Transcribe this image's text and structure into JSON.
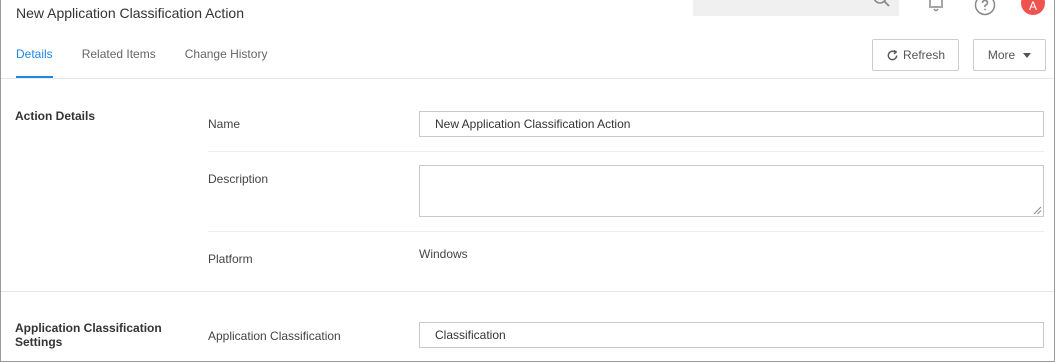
{
  "header": {
    "title": "New Application Classification Action",
    "avatar_initial": "A",
    "avatar_color": "#ef5350"
  },
  "tabs": [
    {
      "label": "Details",
      "active": true
    },
    {
      "label": "Related Items",
      "active": false
    },
    {
      "label": "Change History",
      "active": false
    }
  ],
  "toolbar": {
    "refresh_label": "Refresh",
    "more_label": "More"
  },
  "action_details": {
    "section_title": "Action Details",
    "name_label": "Name",
    "name_value": "New Application Classification Action",
    "description_label": "Description",
    "description_value": "",
    "platform_label": "Platform",
    "platform_value": "Windows"
  },
  "classification_settings": {
    "section_title": "Application Classification Settings",
    "classification_label": "Application Classification",
    "classification_value": "Classification"
  },
  "colors": {
    "accent": "#1e88e5",
    "avatar": "#ef5350"
  },
  "icons": [
    "search-icon",
    "bell-icon",
    "help-icon",
    "refresh-icon",
    "chevron-down-icon",
    "resize-handle-icon"
  ]
}
